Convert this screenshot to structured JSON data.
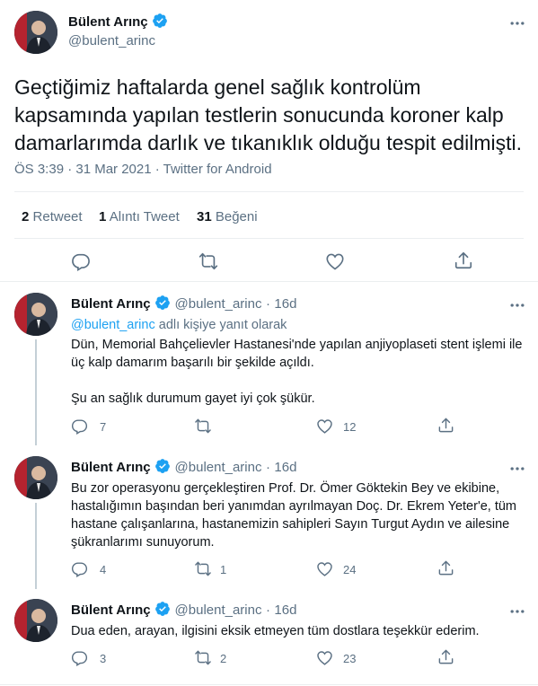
{
  "main": {
    "name": "Bülent Arınç",
    "handle": "@bulent_arinc",
    "text": "Geçtiğimiz haftalarda genel sağlık kontrolüm kapsamında yapılan testlerin sonucunda koroner kalp damarlarımda darlık ve tıkanıklık olduğu tespit edilmişti.",
    "meta": "ÖS 3:39 · 31 Mar 2021 · Twitter for Android",
    "retweets": {
      "count": "2",
      "label": "Retweet"
    },
    "quotes": {
      "count": "1",
      "label": "Alıntı Tweet"
    },
    "likes": {
      "count": "31",
      "label": "Beğeni"
    }
  },
  "replies": [
    {
      "name": "Bülent Arınç",
      "handle": "@bulent_arinc",
      "sep": "·",
      "time": "16d",
      "reply_to_handle": "@bulent_arinc",
      "reply_to_suffix": "adlı kişiye yanıt olarak",
      "p1": "Dün, Memorial Bahçelievler Hastanesi'nde yapılan anjiyoplaseti stent işlemi ile üç kalp damarım başarılı bir şekilde açıldı.",
      "p2": "Şu an sağlık durumum gayet iyi çok şükür.",
      "reply_count": "7",
      "retweet_count": "",
      "like_count": "12"
    },
    {
      "name": "Bülent Arınç",
      "handle": "@bulent_arinc",
      "sep": "·",
      "time": "16d",
      "p1": "Bu zor operasyonu gerçekleştiren Prof. Dr. Ömer Göktekin Bey ve ekibine, hastalığımın başından beri yanımdan ayrılmayan Doç. Dr. Ekrem Yeter'e, tüm hastane çalışanlarına, hastanemizin sahipleri Sayın Turgut Aydın ve ailesine şükranlarımı sunuyorum.",
      "reply_count": "4",
      "retweet_count": "1",
      "like_count": "24"
    },
    {
      "name": "Bülent Arınç",
      "handle": "@bulent_arinc",
      "sep": "·",
      "time": "16d",
      "p1": "Dua eden, arayan, ilgisini eksik etmeyen tüm dostlara teşekkür ederim.",
      "reply_count": "3",
      "retweet_count": "2",
      "like_count": "23"
    }
  ],
  "colors": {
    "accent": "#1da1f2",
    "muted": "#5b7083",
    "text": "#0f1419",
    "divider": "#ebeef0"
  },
  "icons": [
    "verified-badge-icon",
    "more-options-icon",
    "reply-icon",
    "retweet-icon",
    "like-icon",
    "share-icon"
  ]
}
